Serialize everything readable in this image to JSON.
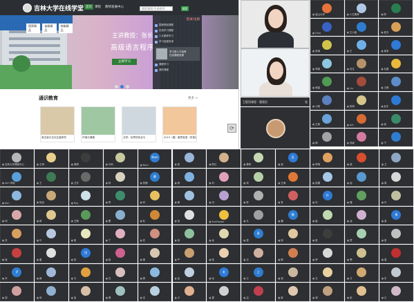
{
  "shared_screen": {
    "site_logo_text": "吉林大学在线学堂",
    "nav": {
      "home": "首页",
      "courses": "课程",
      "teachers": "教师发展中心"
    },
    "search_placeholder": "搜索课程/主讲老师",
    "search_button": "搜索",
    "banner": {
      "lecturer": "主讲教授：张长海",
      "course_title": "高级语言程序设计",
      "cta": "立即学习",
      "chip_tabs": [
        "国家精品",
        "省级精品",
        "校级精品"
      ]
    },
    "login_panel": {
      "header": "登录/注册",
      "lines": [
        "国家精品课程",
        "在线学习课程",
        "人文素养学习",
        "学习进度查询"
      ],
      "box_text_1": "学习型人才培养",
      "box_text_2": "在线课程资源",
      "footer_1": "课程学习",
      "footer_2": "我的课程"
    },
    "section_title": "通识教育",
    "section_more": "更多 >",
    "courses": [
      {
        "name": "英文版与文化互鉴研究",
        "color": "#d9c9a8"
      },
      {
        "name": "环境与健康",
        "color": "#9fc8a2"
      },
      {
        "name": "法学：世界的安全与",
        "color": "#cfd8de"
      },
      {
        "name": "2019（春）雅思英语（学英语）",
        "color": "#f2c79b"
      }
    ]
  },
  "camera_name_bar": "卫星用课程 - 管理员",
  "camera_name_bar_right": "张",
  "side_tiles": [
    {
      "name": "金山大学",
      "c": "#e4743b"
    },
    {
      "name": "人文素养",
      "c": "#b0c8e6"
    },
    {
      "name": "陈",
      "c": "#2a7d4f"
    },
    {
      "name": "Gina",
      "c": "#3a62c4"
    },
    {
      "name": "王小姐",
      "c": "#2f7dd0"
    },
    {
      "name": "夏天",
      "c": "#d9a057"
    },
    {
      "name": "宋涛",
      "c": "#d2c44a"
    },
    {
      "name": "王",
      "c": "#6fb0e8"
    },
    {
      "name": "吴军",
      "c": "#2e7ad6"
    },
    {
      "name": "李源",
      "c": "#8fc7e0"
    },
    {
      "name": "刘文",
      "c": "#b6926a"
    },
    {
      "name": "石磊",
      "c": "#e8b93b"
    },
    {
      "name": "林森",
      "c": "#4f9a55"
    },
    {
      "name": "Liu",
      "c": "#a24c3b"
    },
    {
      "name": "王静",
      "c": "#5d8cc9"
    },
    {
      "name": "小刚",
      "c": "#5b81c0"
    },
    {
      "name": "张明",
      "c": "#d6c68c"
    },
    {
      "name": "赵宇",
      "c": "#2e7ad6"
    },
    {
      "name": "王美",
      "c": "#6aa3d8"
    },
    {
      "name": "Ark",
      "c": "#d76b35"
    },
    {
      "name": "徐",
      "c": "#3b8a6a"
    },
    {
      "name": "周",
      "c": "#a3a3a3"
    },
    {
      "name": "刘颖",
      "c": "#d37ba0"
    },
    {
      "name": "宁",
      "c": "#2f7dd0"
    }
  ],
  "grid_rows": [
    [
      {
        "n": "吉林大学课程中心",
        "c": "#b6b6b6"
      },
      {
        "n": "王海",
        "c": "#e8cf8c"
      },
      {
        "n": "周周",
        "c": "#3d3d3d"
      },
      {
        "n": "马科",
        "c": "#c9c9a0"
      },
      {
        "n": "Nam",
        "c": "#2f7dd0",
        "t": "Nam"
      },
      {
        "n": "张",
        "c": "#9ab6d8"
      },
      {
        "n": "陈红",
        "c": "#d4b38c"
      },
      {
        "n": "秦明",
        "c": "#c6d7b2"
      },
      {
        "n": "吴",
        "c": "#2e7ad6",
        "t": "吴"
      },
      {
        "n": "李明",
        "c": "#e0a060"
      },
      {
        "n": "梁",
        "c": "#d84e2e"
      },
      {
        "n": "卫",
        "c": "#8fa6c5"
      }
    ],
    [
      {
        "n": "Ach 李晓",
        "c": "#5aa0d8"
      },
      {
        "n": "王",
        "c": "#3f7a55"
      },
      {
        "n": "卫东",
        "c": "#6a6a6a"
      },
      {
        "n": "林",
        "c": "#d9d2c1"
      },
      {
        "n": "张静",
        "c": "#2f7dd0",
        "t": "静"
      },
      {
        "n": "杨",
        "c": "#7fb2e0"
      },
      {
        "n": "刘",
        "c": "#e0a0b8"
      },
      {
        "n": "宋",
        "c": "#b8d0a8"
      },
      {
        "n": "王海",
        "c": "#e07838"
      },
      {
        "n": "张娜",
        "c": "#a8c8e6"
      },
      {
        "n": "赵",
        "c": "#5a9ad0"
      },
      {
        "n": "周",
        "c": "#d8d8d8"
      }
    ],
    [
      {
        "n": "Kun",
        "c": "#8cb8e0"
      },
      {
        "n": "徐洁",
        "c": "#c8a878"
      },
      {
        "n": "Ray",
        "c": "#d0e0e8"
      },
      {
        "n": "郑",
        "c": "#3e8e6e"
      },
      {
        "n": "邓",
        "c": "#e8c060"
      },
      {
        "n": "黄",
        "c": "#a0c0e0"
      },
      {
        "n": "冯",
        "c": "#b8a0d0"
      },
      {
        "n": "陈",
        "c": "#b0b0b0"
      },
      {
        "n": "鲁",
        "c": "#d06060"
      },
      {
        "n": "孙",
        "c": "#2e7ad6",
        "t": "孙"
      },
      {
        "n": "唐",
        "c": "#60a060"
      },
      {
        "n": "许",
        "c": "#c0c0a0"
      }
    ],
    [
      {
        "n": "何",
        "c": "#d8a8a8"
      },
      {
        "n": "蒋",
        "c": "#e0c890"
      },
      {
        "n": "王刚",
        "c": "#5a9a5a"
      },
      {
        "n": "曹",
        "c": "#8ab0d0"
      },
      {
        "n": "杜",
        "c": "#d08838"
      },
      {
        "n": "范",
        "c": "#e0e0e0"
      },
      {
        "n": "SunFlower",
        "c": "#f0c040"
      },
      {
        "n": "孔",
        "c": "#a0a0a0"
      },
      {
        "n": "魏",
        "c": "#2f7dd0",
        "t": "魏"
      },
      {
        "n": "崔",
        "c": "#c0d8b0"
      },
      {
        "n": "龙",
        "c": "#d0b0d0"
      },
      {
        "n": "谢",
        "c": "#2e7ad6",
        "t": "谢"
      }
    ],
    [
      {
        "n": "苏",
        "c": "#d8a060"
      },
      {
        "n": "叶",
        "c": "#b8c8e0"
      },
      {
        "n": "程",
        "c": "#e8e8c0"
      },
      {
        "n": "丁",
        "c": "#e0b0c0"
      },
      {
        "n": "任",
        "c": "#d09080"
      },
      {
        "n": "钟",
        "c": "#90c0a0"
      },
      {
        "n": "余",
        "c": "#e0d8b0"
      },
      {
        "n": "袁",
        "c": "#2f7dd0",
        "t": "袁"
      },
      {
        "n": "邱",
        "c": "#e0c8a0"
      },
      {
        "n": "侯",
        "c": "#3d3d3d"
      },
      {
        "n": "贾",
        "c": "#a8d0b0"
      },
      {
        "n": "夏",
        "c": "#c0c0c0"
      }
    ],
    [
      {
        "n": "段",
        "c": "#c84040"
      },
      {
        "n": "雷",
        "c": "#e0e0e0"
      },
      {
        "n": "田",
        "c": "#2e7ad6",
        "t": "田"
      },
      {
        "n": "姚",
        "c": "#d06090"
      },
      {
        "n": "樊",
        "c": "#d8c8b0"
      },
      {
        "n": "严",
        "c": "#c8a070"
      },
      {
        "n": "陆",
        "c": "#e8d0b0"
      },
      {
        "n": "汪",
        "c": "#d0b0a0"
      },
      {
        "n": "柳",
        "c": "#d08050"
      },
      {
        "n": "罗",
        "c": "#d8d8d8"
      },
      {
        "n": "萧",
        "c": "#d0c090"
      },
      {
        "n": "莫",
        "c": "#c03030"
      }
    ],
    [
      {
        "n": "尹",
        "c": "#2f7dd0",
        "t": "尹"
      },
      {
        "n": "薛",
        "c": "#a0b8d8"
      },
      {
        "n": "万",
        "c": "#e0a040"
      },
      {
        "n": "白",
        "c": "#d8c0c0"
      },
      {
        "n": "顾",
        "c": "#8ab8e0"
      },
      {
        "n": "孟",
        "c": "#c0d0e0"
      },
      {
        "n": "毛",
        "c": "#2e7ad6",
        "t": "毛"
      },
      {
        "n": "江",
        "c": "#2f7dd0",
        "t": "江"
      },
      {
        "n": "钱",
        "c": "#c8b8a0"
      },
      {
        "n": "文",
        "c": "#e8d0a0"
      },
      {
        "n": "方",
        "c": "#d0a870"
      },
      {
        "n": "史",
        "c": "#c0c8d0"
      }
    ],
    [
      {
        "n": "邹",
        "c": "#d0a0a0"
      },
      {
        "n": "熊",
        "c": "#90b0d0"
      },
      {
        "n": "金",
        "c": "#d8c0a8"
      },
      {
        "n": "傅",
        "c": "#a0c0c0"
      },
      {
        "n": "沈",
        "c": "#b8d0e0"
      },
      {
        "n": "卢",
        "c": "#e0b090"
      },
      {
        "n": "童",
        "c": "#d0d0d0"
      },
      {
        "n": "吕",
        "c": "#c04050"
      },
      {
        "n": "廖",
        "c": "#e0c8b0"
      },
      {
        "n": "胡",
        "c": "#c0a080"
      },
      {
        "n": "彭",
        "c": "#e0c090"
      },
      {
        "n": "丘",
        "c": "#d0b8c8"
      }
    ]
  ]
}
